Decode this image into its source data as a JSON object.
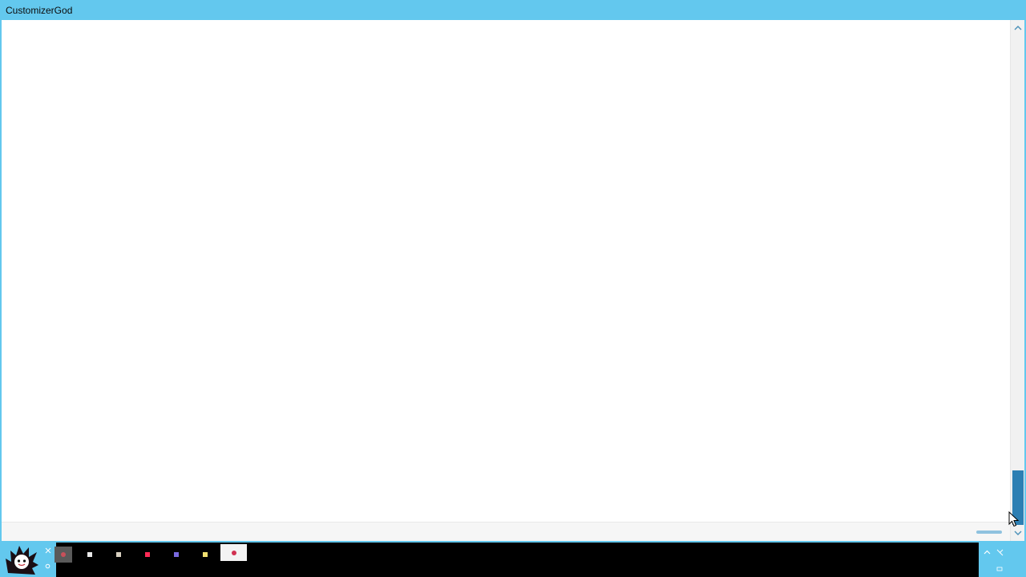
{
  "window": {
    "title": "CustomizerGod"
  },
  "scrollbar": {
    "up_icon": "chevron-up-icon",
    "down_icon": "chevron-down-icon"
  },
  "taskbar": {
    "start_icon": "avatar-start-icon",
    "items": [
      {
        "icon": "app-icon-1",
        "color": "#c8505a"
      },
      {
        "icon": "folder-icon",
        "color": "#e8e8e8"
      },
      {
        "icon": "app-icon-3",
        "color": "#d8d0c0"
      },
      {
        "icon": "app-icon-4",
        "color": "#ff2a55"
      },
      {
        "icon": "app-icon-5",
        "color": "#7a6adf"
      },
      {
        "icon": "app-icon-6",
        "color": "#f0e070"
      },
      {
        "icon": "customizergod-icon",
        "color": "#d03050"
      }
    ],
    "tray": {
      "icons": [
        "arrow-up-icon",
        "network-icon",
        "volume-icon"
      ]
    }
  },
  "colors": {
    "accent": "#63c8ee",
    "scroll_thumb": "#2d7fb3"
  }
}
